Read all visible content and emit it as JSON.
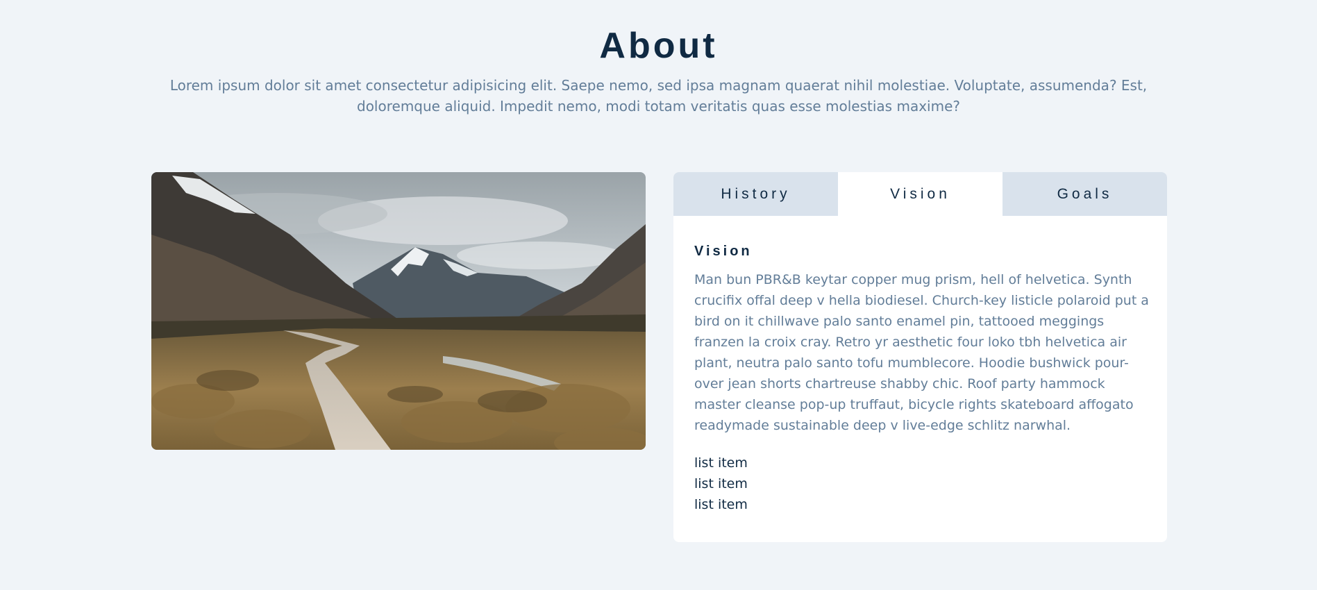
{
  "about": {
    "title": "About",
    "subtitle": "Lorem ipsum dolor sit amet consectetur adipisicing elit. Saepe nemo, sed ipsa magnam quaerat nihil molestiae. Voluptate, assumenda? Est, doloremque aliquid. Impedit nemo, modi totam veritatis quas esse molestias maxime?"
  },
  "tabs": [
    {
      "label": "History",
      "active": false
    },
    {
      "label": "Vision",
      "active": true
    },
    {
      "label": "Goals",
      "active": false
    }
  ],
  "content": {
    "title": "Vision",
    "text": "Man bun PBR&B keytar copper mug prism, hell of helvetica. Synth crucifix offal deep v hella biodiesel. Church-key listicle polaroid put a bird on it chillwave palo santo enamel pin, tattooed meggings franzen la croix cray. Retro yr aesthetic four loko tbh helvetica air plant, neutra palo santo tofu mumblecore. Hoodie bushwick pour-over jean shorts chartreuse shabby chic. Roof party hammock master cleanse pop-up truffaut, bicycle rights skateboard affogato readymade sustainable deep v live-edge schlitz narwhal.",
    "list": [
      "list item",
      "list item",
      "list item"
    ]
  },
  "colors": {
    "background": "#f0f4f8",
    "heading": "#102a43",
    "body_text": "#627d98",
    "tab_inactive": "#d9e2ec",
    "tab_active": "#ffffff"
  }
}
